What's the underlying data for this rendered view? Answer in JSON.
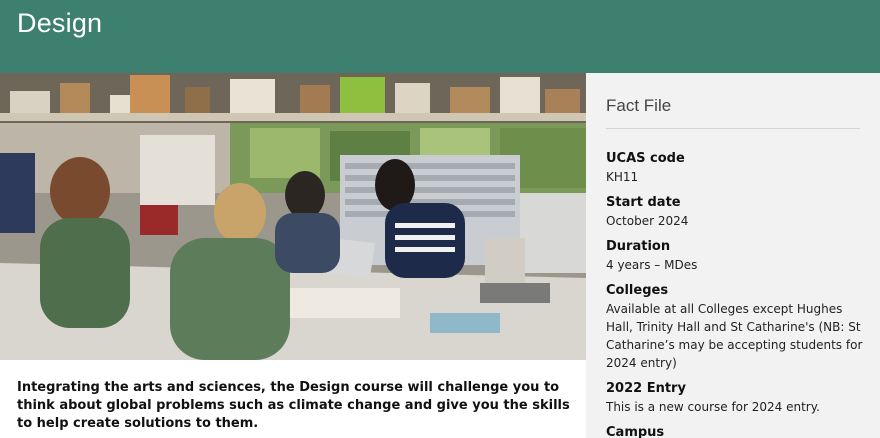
{
  "header": {
    "title": "Design"
  },
  "hero": {
    "alt": "Students working around a table in a design studio"
  },
  "intro": {
    "text": "Integrating the arts and sciences, the Design course will challenge you to think about global problems such as climate change and give you the skills to help create solutions to them."
  },
  "fact_file": {
    "title": "Fact File",
    "items": [
      {
        "label": "UCAS code",
        "value": "KH11"
      },
      {
        "label": "Start date",
        "value": "October 2024"
      },
      {
        "label": "Duration",
        "value": "4 years – MDes"
      },
      {
        "label": "Colleges",
        "value": "Available at all Colleges except Hughes Hall, Trinity Hall and St Catharine's (NB: St Catharine’s may be accepting students for 2024 entry)"
      },
      {
        "label": "2022 Entry",
        "value": "This is a new course for 2024 entry."
      },
      {
        "label": "Campus",
        "value": ""
      }
    ]
  }
}
